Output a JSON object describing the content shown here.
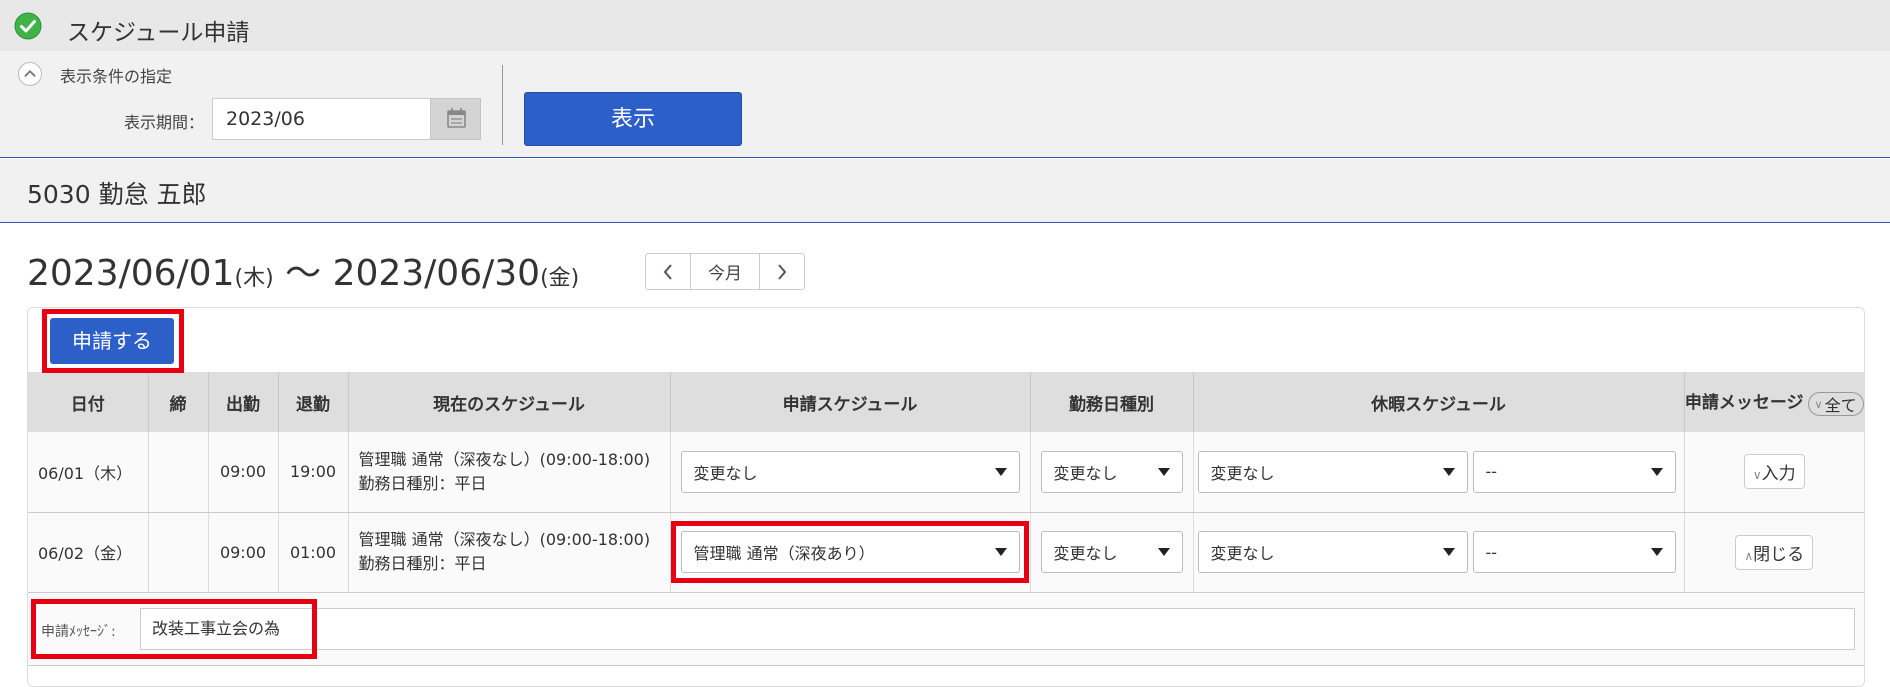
{
  "header": {
    "title": "スケジュール申請"
  },
  "conditions": {
    "label": "表示条件の指定",
    "period_label": "表示期間：",
    "period_value": "2023/06",
    "show_button": "表示"
  },
  "employee": {
    "name": "5030 勤怠 五郎"
  },
  "range": {
    "start": "2023/06/01",
    "start_dow": "(木)",
    "sep": " 〜 ",
    "end": "2023/06/30",
    "end_dow": "(金)"
  },
  "pager": {
    "current": "今月"
  },
  "apply_button": "申請する",
  "columns": [
    "日付",
    "締",
    "出勤",
    "退勤",
    "現在のスケジュール",
    "申請スケジュール",
    "勤務日種別",
    "休暇スケジュール",
    "申請メッセージ"
  ],
  "all_toggle": "全て",
  "rows": [
    {
      "date": "06/01（木）",
      "close": "",
      "in": "09:00",
      "out": "19:00",
      "schedule_line1": "管理職 通常（深夜なし）(09:00-18:00)",
      "schedule_line2": "勤務日種別：平日",
      "apply_schedule": "変更なし",
      "day_type": "変更なし",
      "leave1": "変更なし",
      "leave2": "--",
      "msg_button": "入力"
    },
    {
      "date": "06/02（金）",
      "close": "",
      "in": "09:00",
      "out": "01:00",
      "schedule_line1": "管理職 通常（深夜なし）(09:00-18:00)",
      "schedule_line2": "勤務日種別：平日",
      "apply_schedule": "管理職 通常（深夜あり）",
      "day_type": "変更なし",
      "leave1": "変更なし",
      "leave2": "--",
      "msg_button": "閉じる"
    }
  ],
  "message": {
    "label": "申請ﾒｯｾｰｼﾞ:",
    "value": "改装工事立会の為"
  },
  "colors": {
    "accent": "#2d5fc8",
    "highlight": "#e60012",
    "check": "#3fb24a"
  }
}
